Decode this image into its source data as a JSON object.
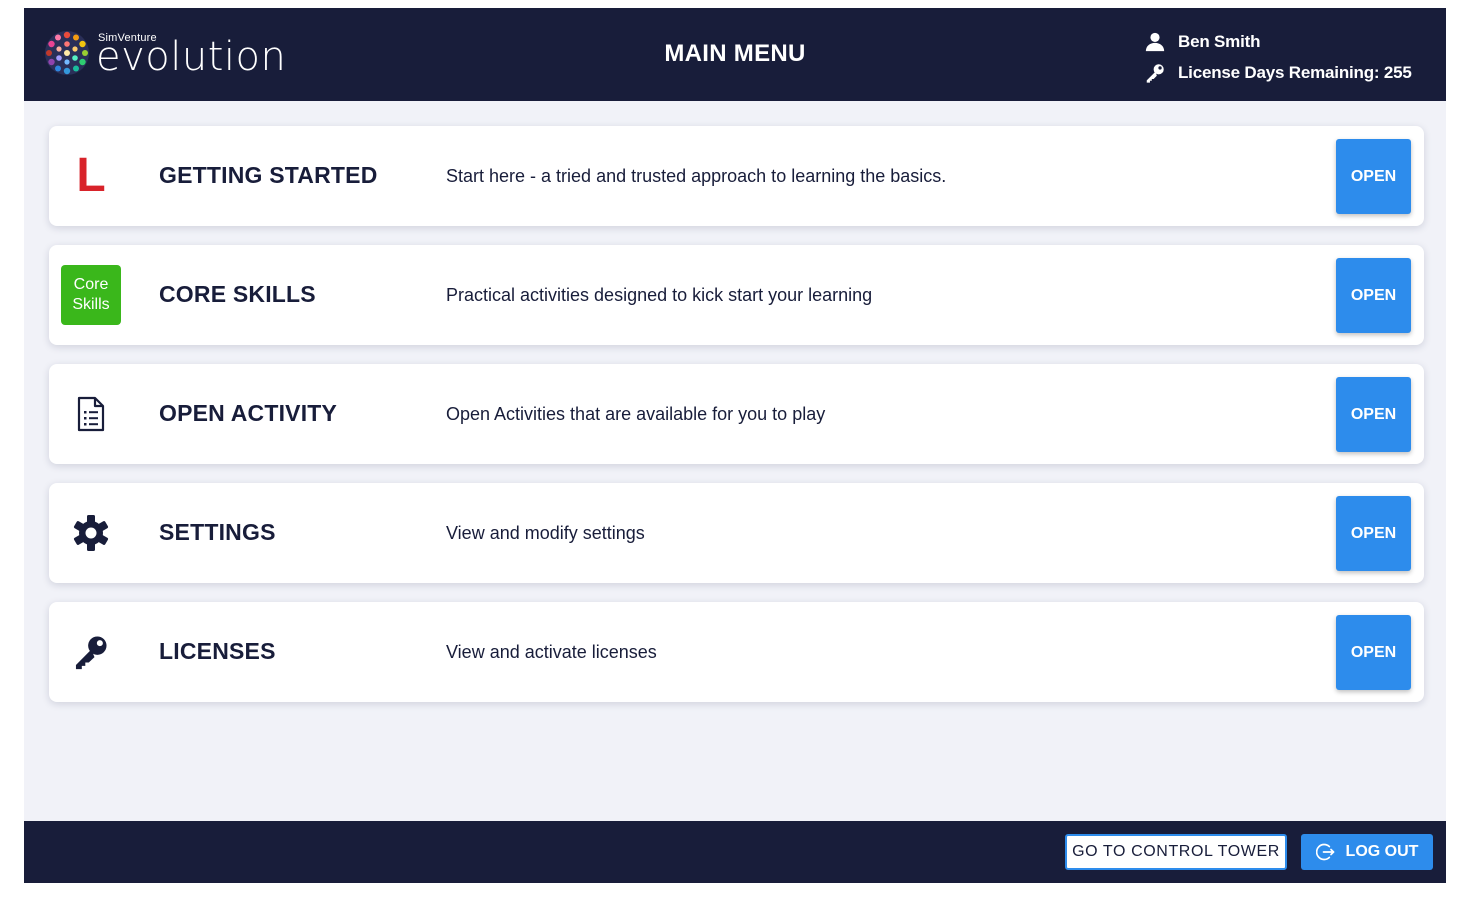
{
  "header": {
    "logo": {
      "brand_small": "SimVenture",
      "brand_big": "evolution"
    },
    "title": "MAIN MENU",
    "user": {
      "name": "Ben Smith",
      "license_text": "License Days Remaining: 255",
      "user_icon": "user-icon",
      "key_icon": "key-icon"
    }
  },
  "menu": {
    "items": [
      {
        "icon": "L",
        "title": "GETTING STARTED",
        "description": "Start here - a tried and trusted approach to learning the basics.",
        "button": "OPEN"
      },
      {
        "icon": "Core Skills",
        "icon_line1": "Core",
        "icon_line2": "Skills",
        "title": "CORE SKILLS",
        "description": "Practical activities designed to kick start your learning",
        "button": "OPEN"
      },
      {
        "icon": "document-list-icon",
        "title": "OPEN ACTIVITY",
        "description": "Open Activities that are available for you to play",
        "button": "OPEN"
      },
      {
        "icon": "gear-icon",
        "title": "SETTINGS",
        "description": "View and modify settings",
        "button": "OPEN"
      },
      {
        "icon": "key-icon",
        "title": "LICENSES",
        "description": "View and activate licenses",
        "button": "OPEN"
      }
    ]
  },
  "footer": {
    "control_tower": "GO TO CONTROL TOWER",
    "logout": "LOG OUT",
    "logout_icon": "logout-icon"
  },
  "colors": {
    "header_bg": "#181d3a",
    "accent_blue": "#2d8cec",
    "getting_started_red": "#d8232a",
    "core_skills_green": "#3ab71b",
    "page_bg": "#f1f2f8"
  }
}
